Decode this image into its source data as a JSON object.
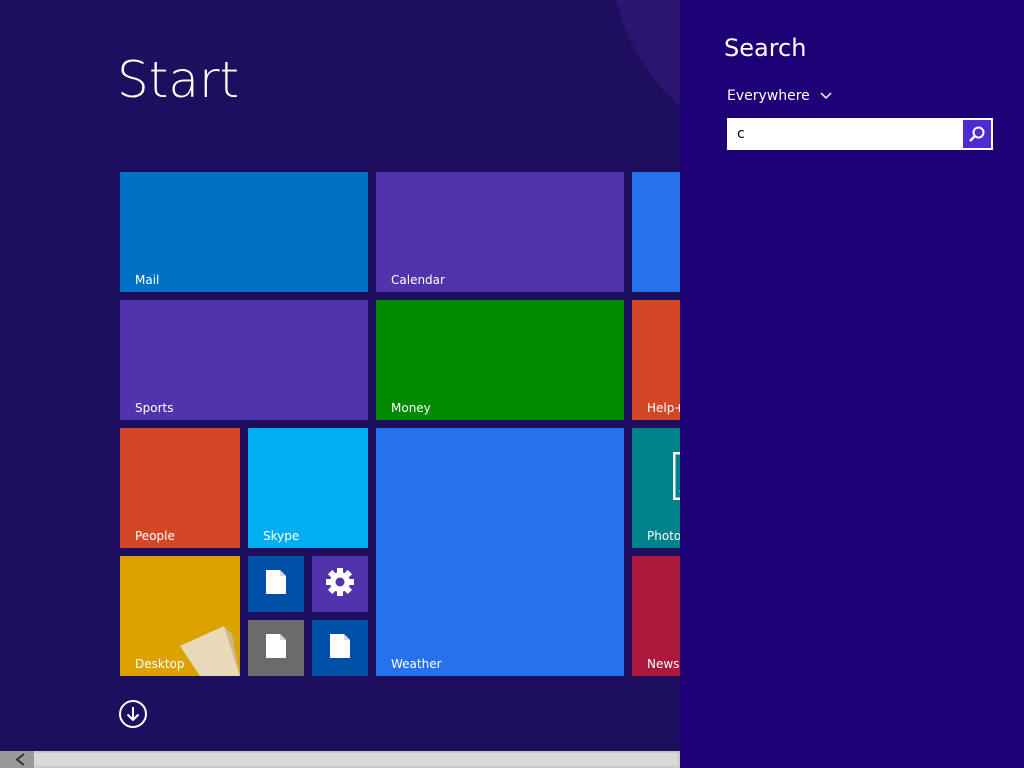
{
  "start": {
    "title": "Start",
    "tiles": {
      "mail": "Mail",
      "calendar": "Calendar",
      "sports": "Sports",
      "money": "Money",
      "help": "Help+",
      "people": "People",
      "skype": "Skype",
      "weather": "Weather",
      "photos": "Photo",
      "desktop": "Desktop",
      "news": "News"
    }
  },
  "search": {
    "title": "Search",
    "scope": "Everywhere",
    "query": "c"
  },
  "colors": {
    "background": "#1e0e5e",
    "search_pane": "#1e0076",
    "mail": "#0072c6",
    "calendar": "#5133ab",
    "sports": "#5133ab",
    "money": "#008a00",
    "help": "#d24726",
    "people": "#d24726",
    "skype": "#00aff0",
    "weather": "#2672ec",
    "photos": "#00828b",
    "desktop": "#dca300",
    "news": "#ac193d",
    "search_button": "#4e2bd0"
  },
  "icons": {
    "down_arrow": "arrow-down-circle-icon",
    "scope_chevron": "chevron-down-icon",
    "search": "magnifier-icon",
    "settings": "gear-icon",
    "document": "document-icon",
    "scroll_left": "chevron-left-icon"
  }
}
